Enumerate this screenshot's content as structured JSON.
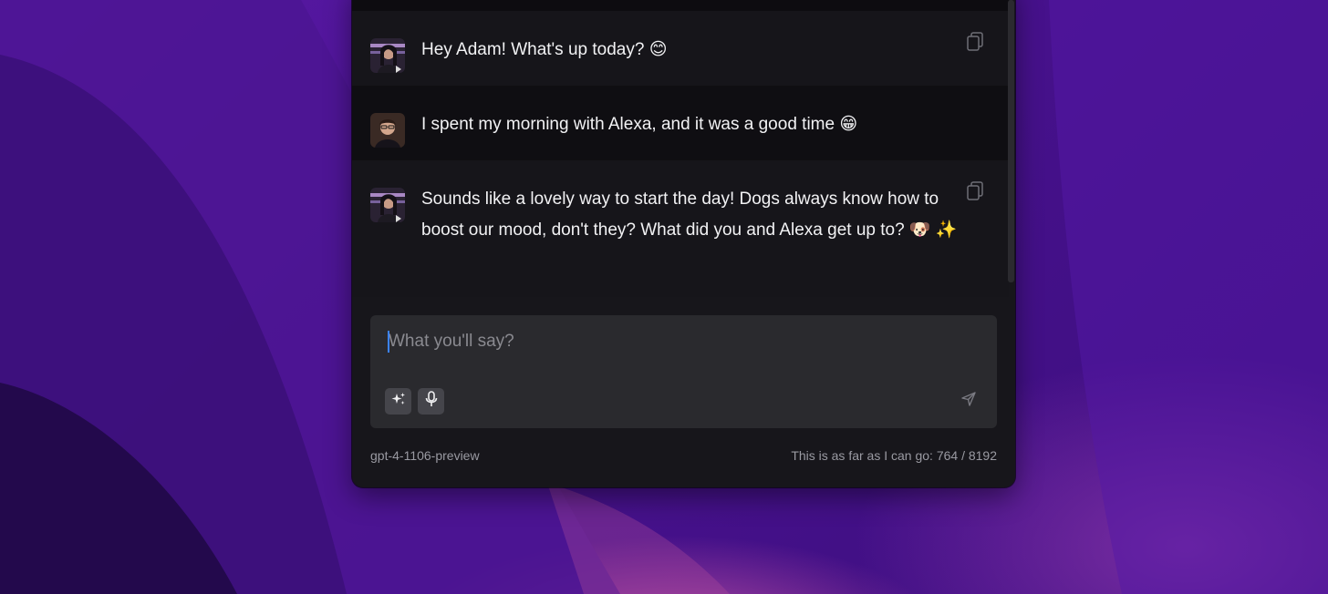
{
  "messages": [
    {
      "role": "assistant",
      "avatar": "assistant-avatar",
      "text": "Hey Adam! What's up today? 😊",
      "actions": [
        "copy-icon"
      ]
    },
    {
      "role": "user",
      "avatar": "user-avatar",
      "text": "I spent my morning with Alexa, and it was a good time 😁",
      "actions": []
    },
    {
      "role": "assistant",
      "avatar": "assistant-avatar",
      "text": "Sounds like a lovely way to start the day! Dogs always know how to boost our mood, don't they? What did you and Alexa get up to? 🐶 ✨",
      "actions": [
        "copy-icon"
      ]
    }
  ],
  "composer": {
    "placeholder": "What you'll say?",
    "value": "",
    "tools": [
      "sparkles-icon",
      "microphone-icon"
    ],
    "send_icon": "send-icon"
  },
  "footer": {
    "model": "gpt-4-1106-preview",
    "token_usage": "This is as far as I can go: 764 / 8192"
  },
  "colors": {
    "window_bg": "#17161b",
    "message_assistant_bg": "#16151a",
    "message_user_bg": "#0f0e12",
    "composer_bg": "#2a2a2e",
    "caret": "#3b82f6",
    "wallpaper_primary": "#4a1290"
  }
}
